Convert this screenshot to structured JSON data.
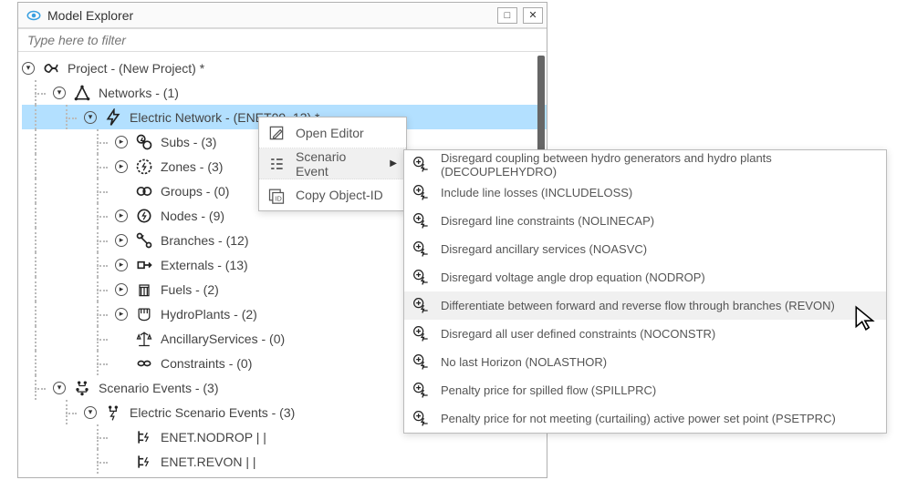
{
  "window": {
    "title": "Model Explorer",
    "minimize": "□",
    "close": "✕"
  },
  "filter": {
    "placeholder": "Type here to filter"
  },
  "tree": {
    "root": {
      "label": "Project - (New Project) *"
    },
    "networks": {
      "label": "Networks - (1)"
    },
    "enet": {
      "label": "Electric Network - (ENET09_13) *"
    },
    "subs": {
      "label": "Subs - (3)"
    },
    "zones": {
      "label": "Zones - (3)"
    },
    "groups": {
      "label": "Groups - (0)"
    },
    "nodes": {
      "label": "Nodes - (9)"
    },
    "branches": {
      "label": "Branches - (12)"
    },
    "externals": {
      "label": "Externals - (13)"
    },
    "fuels": {
      "label": "Fuels - (2)"
    },
    "hydroplants": {
      "label": "HydroPlants - (2)"
    },
    "ancillary": {
      "label": "AncillaryServices - (0)"
    },
    "constraints": {
      "label": "Constraints - (0)"
    },
    "scenario_events": {
      "label": "Scenario Events - (3)"
    },
    "elec_scenario_events": {
      "label": "Electric Scenario Events - (3)"
    },
    "ev_nodrop": {
      "label": "ENET.NODROP |  |"
    },
    "ev_revon": {
      "label": "ENET.REVON |  |"
    }
  },
  "ctx1": {
    "open_editor": "Open Editor",
    "scenario_event": "Scenario Event",
    "copy_id": "Copy Object-ID"
  },
  "ctx2": {
    "items": [
      "Disregard coupling between hydro generators and hydro plants (DECOUPLEHYDRO)",
      "Include line losses (INCLUDELOSS)",
      "Disregard line constraints (NOLINECAP)",
      "Disregard ancillary services (NOASVC)",
      "Disregard voltage angle drop equation (NODROP)",
      "Differentiate between forward and reverse flow through branches (REVON)",
      "Disregard all user defined constraints (NOCONSTR)",
      "No last Horizon (NOLASTHOR)",
      "Penalty price for spilled flow (SPILLPRC)",
      "Penalty price for not meeting (curtailing) active power set point  (PSETPRC)"
    ],
    "hover_index": 5
  }
}
